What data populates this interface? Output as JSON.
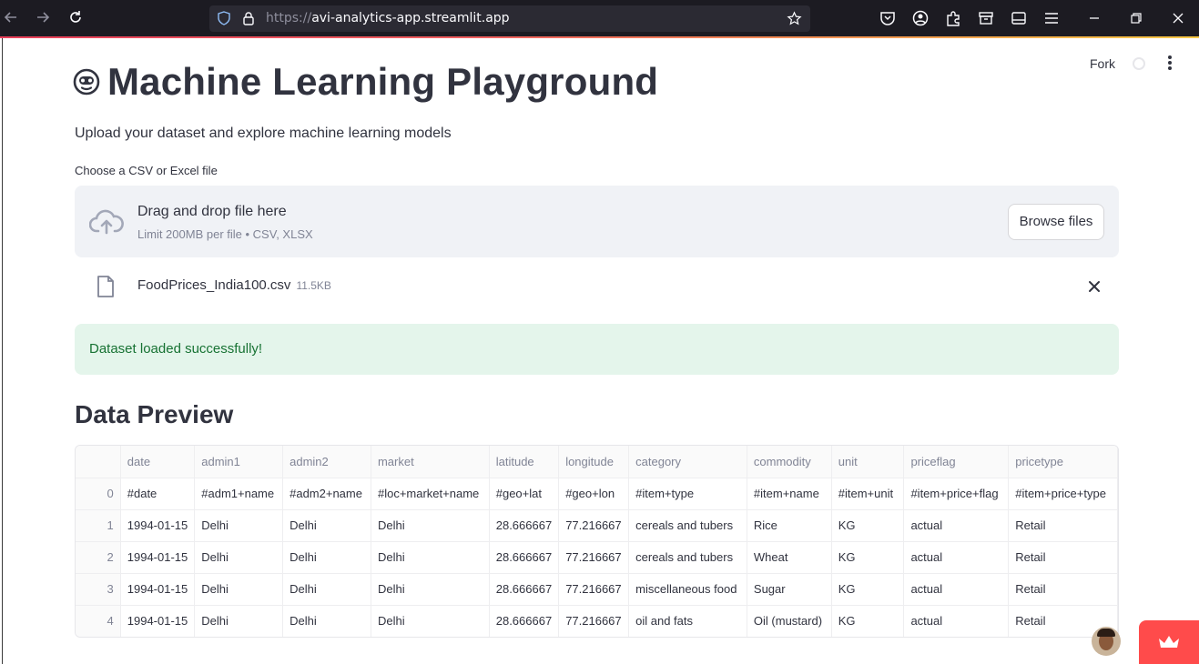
{
  "browser": {
    "url_protocol": "https://",
    "url_host": "avi-analytics-app.streamlit.app"
  },
  "header": {
    "fork_label": "Fork"
  },
  "app": {
    "title": "Machine Learning Playground",
    "subtitle": "Upload your dataset and explore machine learning models"
  },
  "uploader": {
    "label": "Choose a CSV or Excel file",
    "drop_title": "Drag and drop file here",
    "drop_limits": "Limit 200MB per file • CSV, XLSX",
    "browse_label": "Browse files",
    "file_name": "FoodPrices_India100.csv",
    "file_size": "11.5KB"
  },
  "status": {
    "message": "Dataset loaded successfully!",
    "color": "#177233"
  },
  "preview": {
    "title": "Data Preview",
    "columns": [
      "",
      "date",
      "admin1",
      "admin2",
      "market",
      "latitude",
      "longitude",
      "category",
      "commodity",
      "unit",
      "priceflag",
      "pricetype"
    ],
    "rows": [
      [
        "0",
        "#date",
        "#adm1+name",
        "#adm2+name",
        "#loc+market+name",
        "#geo+lat",
        "#geo+lon",
        "#item+type",
        "#item+name",
        "#item+unit",
        "#item+price+flag",
        "#item+price+type"
      ],
      [
        "1",
        "1994-01-15",
        "Delhi",
        "Delhi",
        "Delhi",
        "28.666667",
        "77.216667",
        "cereals and tubers",
        "Rice",
        "KG",
        "actual",
        "Retail"
      ],
      [
        "2",
        "1994-01-15",
        "Delhi",
        "Delhi",
        "Delhi",
        "28.666667",
        "77.216667",
        "cereals and tubers",
        "Wheat",
        "KG",
        "actual",
        "Retail"
      ],
      [
        "3",
        "1994-01-15",
        "Delhi",
        "Delhi",
        "Delhi",
        "28.666667",
        "77.216667",
        "miscellaneous food",
        "Sugar",
        "KG",
        "actual",
        "Retail"
      ],
      [
        "4",
        "1994-01-15",
        "Delhi",
        "Delhi",
        "Delhi",
        "28.666667",
        "77.216667",
        "oil and fats",
        "Oil (mustard)",
        "KG",
        "actual",
        "Retail"
      ]
    ]
  },
  "icons": {
    "back": "arrow-left-icon",
    "forward": "arrow-right-icon",
    "reload": "reload-icon",
    "tracking": "shield-icon",
    "lock": "lock-icon",
    "bookmark": "star-icon",
    "pocket": "pocket-icon",
    "account": "account-icon",
    "extensions": "puzzle-icon",
    "containers": "container-icon",
    "sidebar": "sidebar-icon",
    "menu": "hamburger-icon",
    "upload": "cloud-upload-icon",
    "file": "file-icon",
    "close": "close-icon"
  },
  "colors": {
    "accent": "#ff4b4b",
    "dropzone_bg": "#f0f2f6",
    "success_bg": "#e4f5eb"
  }
}
